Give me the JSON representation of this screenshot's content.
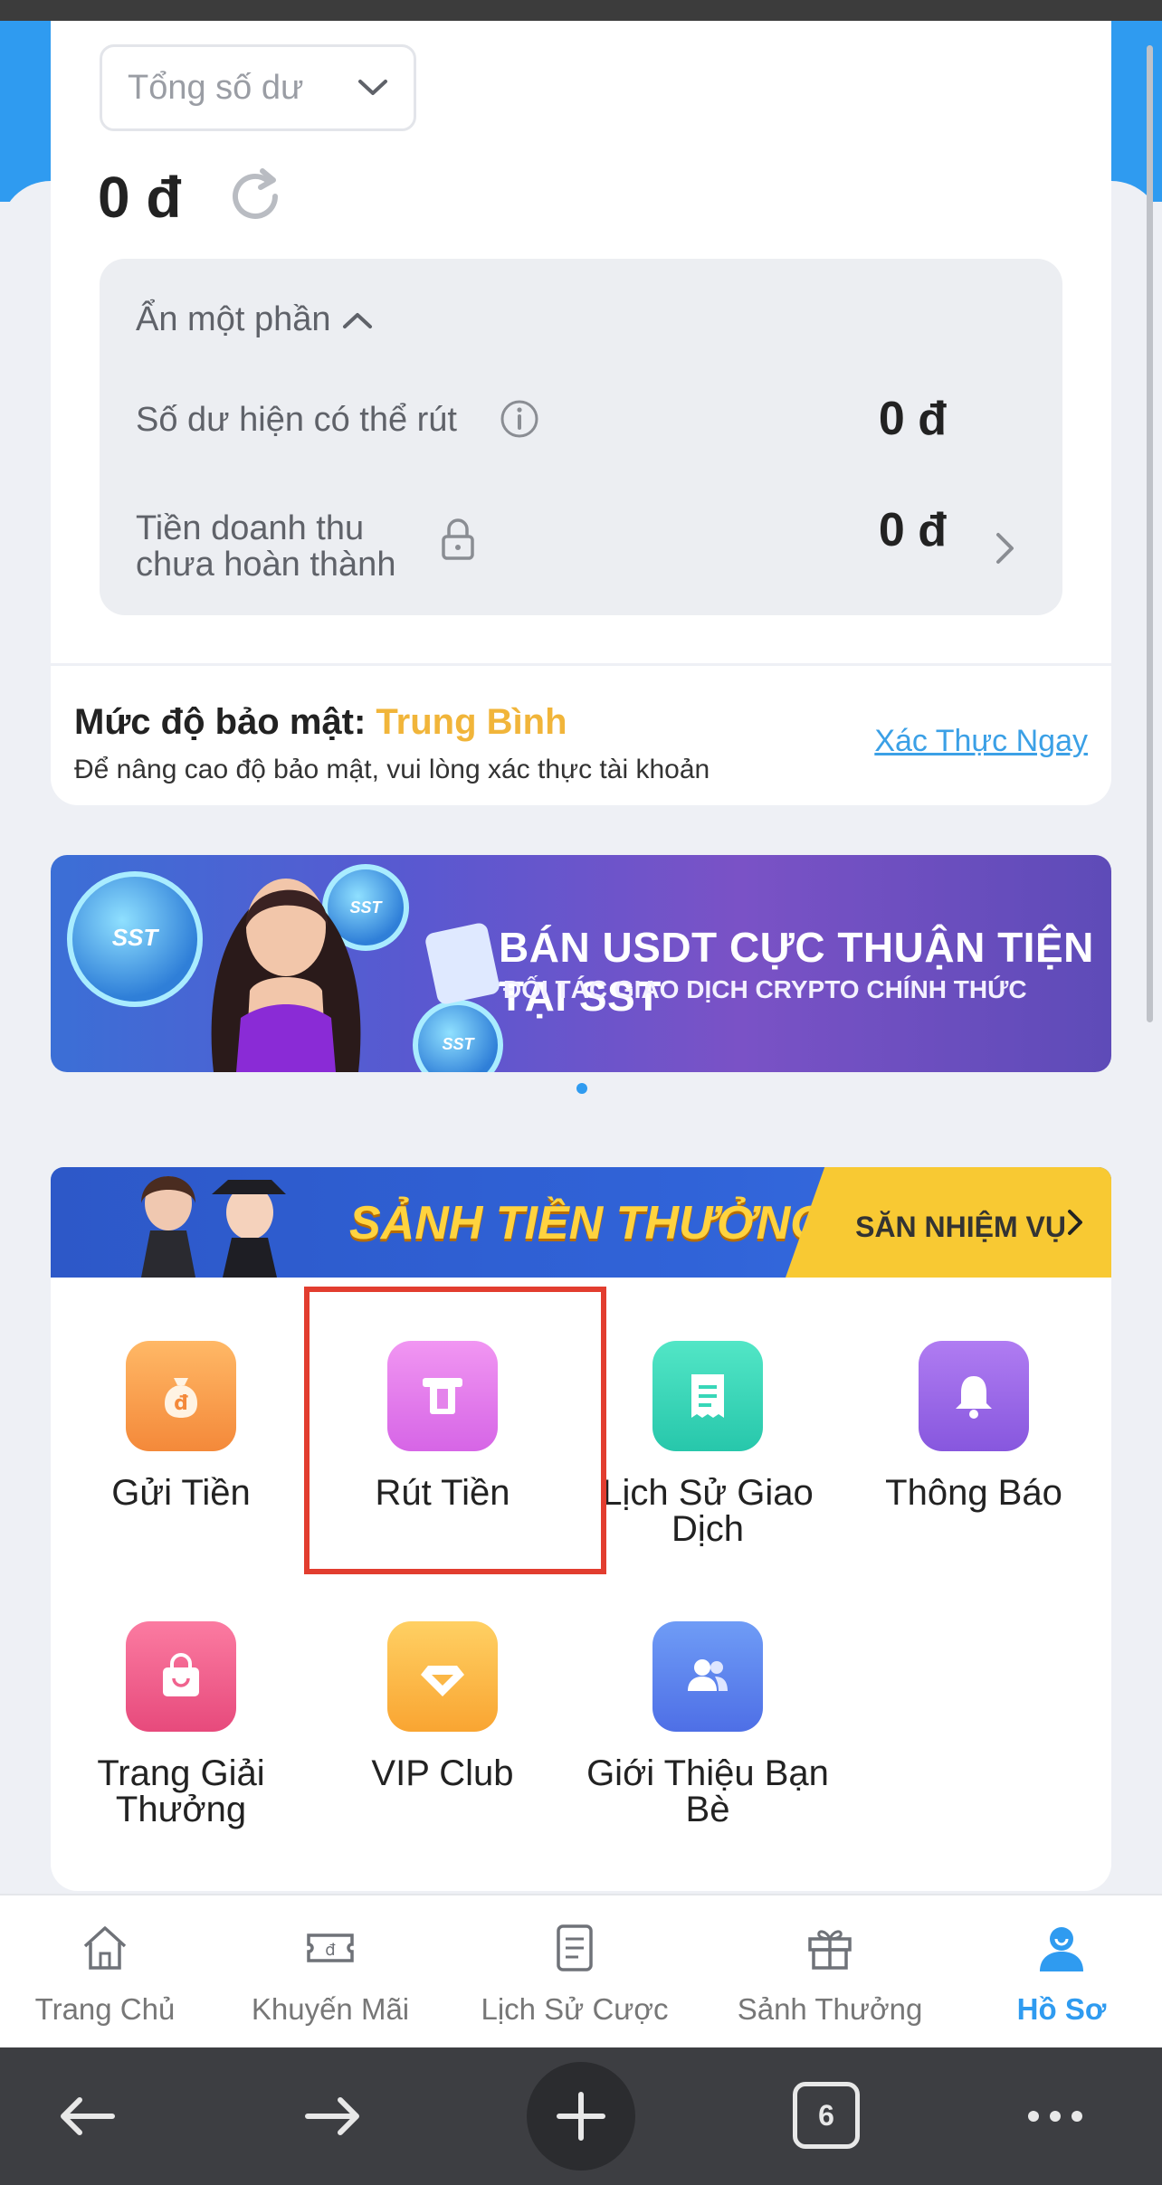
{
  "balance": {
    "selector_label": "Tổng số dư",
    "amount": "0 đ",
    "collapse_label": "Ẩn một phần",
    "withdrawable_label": "Số dư hiện có thể rút",
    "withdrawable_value": "0 đ",
    "turnover_label_1": "Tiền doanh thu",
    "turnover_label_2": "chưa hoàn thành",
    "turnover_value": "0 đ"
  },
  "security": {
    "title": "Mức độ bảo mật: ",
    "level": "Trung Bình",
    "description": "Để nâng cao độ bảo mật, vui lòng xác thực tài khoản",
    "verify_link": "Xác Thực Ngay"
  },
  "promo_banner": {
    "headline": "BÁN USDT CỰC THUẬN TIỆN TẠI SST",
    "subline": "ĐỐI TÁC GIAO DỊCH CRYPTO CHÍNH THỨC",
    "coin_label": "SST"
  },
  "reward_banner": {
    "title": "SẢNH TIỀN THƯỞNG",
    "button": "SĂN NHIỆM VỤ"
  },
  "menu": {
    "items": [
      {
        "label": "Gửi Tiền",
        "icon": "money-bag-icon",
        "color": "#f7a04a"
      },
      {
        "label": "Rút Tiền",
        "icon": "atm-card-icon",
        "color": "#e47ae8"
      },
      {
        "label_1": "Lịch Sử Giao",
        "label_2": "Dịch",
        "icon": "receipt-icon",
        "color": "#37d7b8"
      },
      {
        "label": "Thông Báo",
        "icon": "bell-icon",
        "color": "#9b6ae8"
      },
      {
        "label_1": "Trang Giải",
        "label_2": "Thưởng",
        "icon": "shopping-bag-icon",
        "color": "#f0638e"
      },
      {
        "label": "VIP Club",
        "icon": "diamond-icon",
        "color": "#fbb746"
      },
      {
        "label_1": "Giới Thiệu Bạn",
        "label_2": "Bè",
        "icon": "users-icon",
        "color": "#5b82ee"
      }
    ]
  },
  "bottom_nav": {
    "items": [
      {
        "label": "Trang Chủ",
        "icon": "home-icon"
      },
      {
        "label": "Khuyến Mãi",
        "icon": "ticket-icon"
      },
      {
        "label": "Lịch Sử Cược",
        "icon": "document-icon"
      },
      {
        "label": "Sảnh Thưởng",
        "icon": "gift-icon"
      },
      {
        "label": "Hồ Sơ",
        "icon": "profile-icon",
        "active": true
      }
    ]
  },
  "browser": {
    "tab_count": "6"
  },
  "colors": {
    "accent": "#2f9bf0",
    "security_level": "#f1b53a",
    "highlight_box": "#e23d2f"
  }
}
